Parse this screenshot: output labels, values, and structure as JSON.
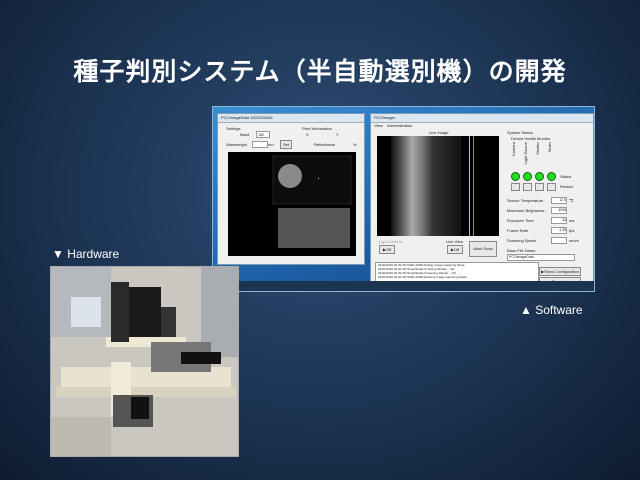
{
  "slide": {
    "title": "種子判別システム（半自動選別機）の開発",
    "hardware_caption": "▼ Hardware",
    "software_caption": "▲ Software"
  },
  "left_window": {
    "title": "PCOImageData 3333333446",
    "settings_label": "Settings",
    "band_label": "Band",
    "band_value": "180",
    "wavelength_label": "Wavelength",
    "wavelength_unit": "nm",
    "pixel_info_label": "Pixel Information",
    "x_label": "X",
    "y_label": "Y",
    "reflectance_label": "Reflectance",
    "reflectance_unit": "%",
    "set_button": "Set"
  },
  "right_window": {
    "title": "PCOImager",
    "menu_view": "View",
    "menu_admin": "Administration",
    "live_image_label": "Live Image",
    "light_control_label": "Light Control",
    "live_view_label": "Live View",
    "off_button_1": "▶Off",
    "off_button_2": "▶Off",
    "abort_scan_button": "Abort Scan",
    "system_status_label": "System Status",
    "device_health_label": "Device Health Monitor",
    "device_names": [
      "Camera",
      "Light Source",
      "Shutter",
      "Slider"
    ],
    "status_label": "Status",
    "restart_label": "Restart",
    "sensor_temp_label": "Sensor Temperature",
    "sensor_temp_value": "12.0",
    "sensor_temp_unit": "℃",
    "max_brightness_label": "Maximum Brightness",
    "max_brightness_value": "4095",
    "exposure_label": "Exposure Time",
    "exposure_value": "34",
    "exposure_unit": "ms",
    "frame_rate_label": "Frame Rate",
    "frame_rate_value": "4.35",
    "frame_rate_unit": "fps",
    "scan_speed_label": "Scanning Speed",
    "scan_speed_unit": "mm/s",
    "base_file_label": "Base File Name",
    "base_file_value": "PCOImageData",
    "show_config_button": "▶Show Configuration",
    "clear_log_button": "Clear Log",
    "log_lines": [
      "2016/10/20 20:40:46 [VNIR-200R] Exiting Image Capturing Mode.",
      "2016/10/20 20:40:46 [SmartShutter] Closing Shutter... OK.",
      "2016/10/20 20:40:46 [SmartShutter] Opening Shutter... OK.",
      "2016/10/20 20:40:46 [VNIR-200R] Entering Image Capturing Mode."
    ]
  }
}
